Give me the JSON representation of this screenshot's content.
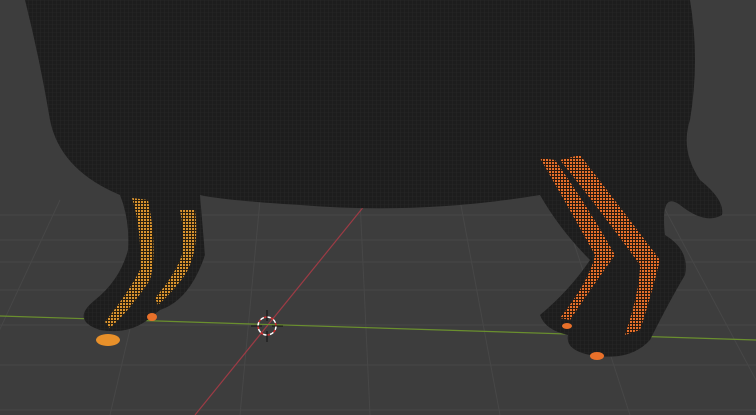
{
  "viewport": {
    "mode": "edit",
    "colors": {
      "background": "#3d3d3d",
      "grid": "#4a4a4a",
      "x_axis": "#9c3b45",
      "y_axis": "#6a8f2e",
      "mesh": "#1c1c1c",
      "wire": "#2b2b2b",
      "selection": "#e8702a",
      "selection_light": "#f2a13a"
    },
    "icons": [
      "3d-cursor-icon"
    ]
  }
}
